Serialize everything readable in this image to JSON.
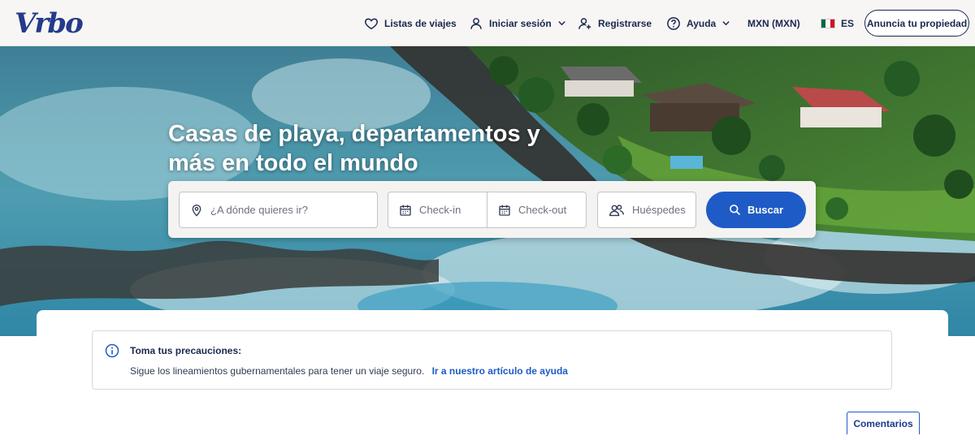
{
  "header": {
    "logo_text": "Vrbo",
    "nav": {
      "lists_label": "Listas de viajes",
      "login_label": "Iniciar sesión",
      "register_label": "Registrarse",
      "help_label": "Ayuda",
      "currency_label": "MXN (MXN)",
      "language_label": "ES"
    },
    "advertise_label": "Anuncia tu propiedad"
  },
  "hero": {
    "title_line1": "Casas de playa, departamentos y",
    "title_line2": "más en todo el mundo"
  },
  "search": {
    "destination_placeholder": "¿A dónde quieres ir?",
    "checkin_label": "Check-in",
    "checkout_label": "Check-out",
    "guests_label": "Huéspedes",
    "search_button_label": "Buscar"
  },
  "notice": {
    "title": "Toma tus precauciones:",
    "body": "Sigue los lineamientos gubernamentales para tener un viaje seguro.",
    "link_label": "Ir a nuestro artículo de ayuda"
  },
  "feedback_label": "Comentarios",
  "colors": {
    "brand_navy": "#1b2850",
    "logo_blue": "#253a8c",
    "accent_blue": "#1e5bc6"
  }
}
